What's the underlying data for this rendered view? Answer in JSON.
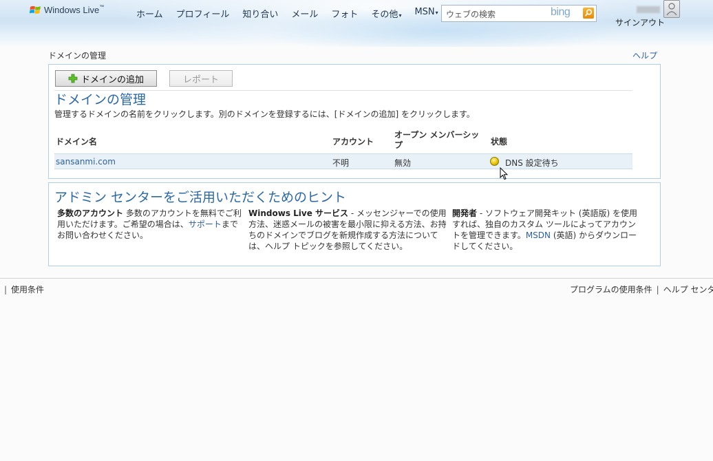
{
  "header": {
    "brand": "Windows Live",
    "trademark": "™",
    "nav": [
      {
        "label": "ホーム",
        "caret": ""
      },
      {
        "label": "プロフィール",
        "caret": ""
      },
      {
        "label": "知り合い",
        "caret": ""
      },
      {
        "label": "メール",
        "caret": ""
      },
      {
        "label": "フォト",
        "caret": ""
      },
      {
        "label": "その他",
        "caret": "▾"
      },
      {
        "label": "MSN",
        "caret": "▾"
      }
    ],
    "search_placeholder": "ウェブの検索",
    "bing": "bing",
    "signout": "サインアウト"
  },
  "breadcrumb": "ドメインの管理",
  "help": "ヘルプ",
  "domains": {
    "add_button": "ドメインの追加",
    "report_button": "レポート",
    "title": "ドメインの管理",
    "description": "管理するドメインの名前をクリックします。別のドメインを登録するには、[ドメインの追加] をクリックします。",
    "columns": {
      "domain": "ドメイン名",
      "account": "アカウント",
      "open": "オープン メンバーシッ",
      "open2": "プ",
      "status": "状態"
    },
    "rows": [
      {
        "domain": "sansanmi.com",
        "account": "不明",
        "open": "無効",
        "status": "DNS 設定待ち"
      }
    ]
  },
  "tips": {
    "title": "アドミン センターをご活用いただくためのヒント",
    "col1": {
      "bold": "多数のアカウント",
      "text_a": " 多数のアカウントを無料でご利用いただけます。ご希望の場合は、",
      "link": "サポート",
      "text_b": "までお問い合わせください。"
    },
    "col2": {
      "bold": "Windows Live サービス",
      "text": " - メッセンジャーでの使用方法、迷惑メールの被害を最小限に抑える方法、お持ちのドメインでブログを新規作成する方法については、ヘルプ トピックを参照してください。"
    },
    "col3": {
      "bold": "開発者",
      "text_a": " - ソフトウェア開発キット (英語版) を使用すれば、独自のカスタム ツールによってアカウントを管理できます。",
      "link": "MSDN",
      "text_b": " (英語) からダウンロードしてください。"
    }
  },
  "footer": {
    "left_sep": "|",
    "terms": "使用条件",
    "program_terms": "プログラムの使用条件",
    "help_center": "ヘルプ センタ"
  },
  "colors": {
    "accent": "#2b69a3",
    "link": "#2c5f9e",
    "panel_border": "#aed0e6",
    "row_bg": "#e9f1f8"
  }
}
